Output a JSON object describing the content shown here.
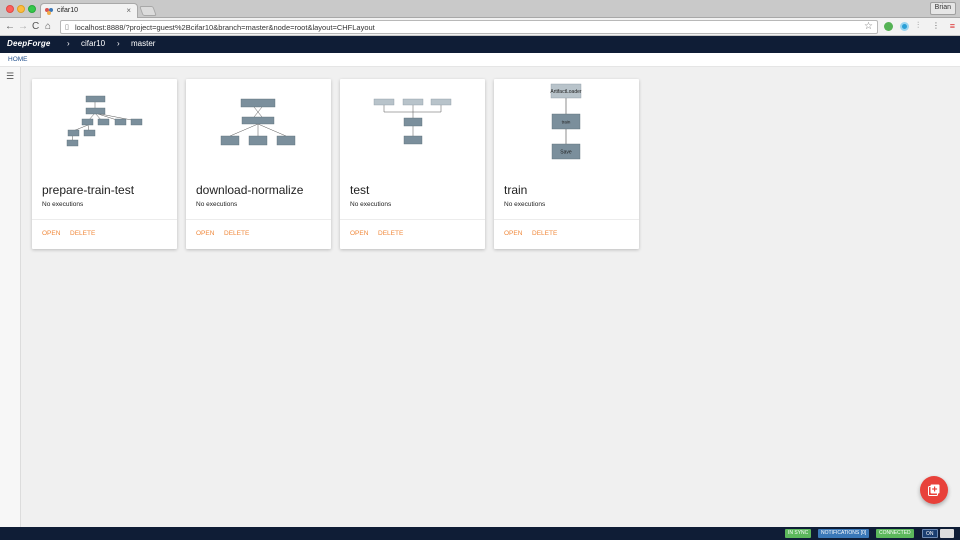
{
  "browser": {
    "tab_title": "cifar10",
    "user_name": "Brian",
    "url": "localhost:8888/?project=guest%2Bcifar10&branch=master&node=root&layout=CHFLayout"
  },
  "header": {
    "logo": "DeepForge",
    "project": "cifar10",
    "branch": "master"
  },
  "subnav": {
    "home": "HOME"
  },
  "cards": [
    {
      "title": "prepare-train-test",
      "status": "No executions",
      "open": "OPEN",
      "delete": "DELETE"
    },
    {
      "title": "download-normalize",
      "status": "No executions",
      "open": "OPEN",
      "delete": "DELETE"
    },
    {
      "title": "test",
      "status": "No executions",
      "open": "OPEN",
      "delete": "DELETE"
    },
    {
      "title": "train",
      "status": "No executions",
      "open": "OPEN",
      "delete": "DELETE",
      "nodes": [
        "ArtifactLoader",
        "train",
        "Save"
      ]
    }
  ],
  "footer": {
    "sync": "IN SYNC",
    "notifications": "NOTIFICATIONS [0]",
    "connected": "CONNECTED",
    "on": "ON"
  },
  "colors": {
    "header_bg": "#0f1d36",
    "accent": "#f0893c",
    "node_fill": "#7b8f9c",
    "fab": "#e8413a"
  },
  "icons": [
    "back-icon",
    "forward-icon",
    "reload-icon",
    "home-icon",
    "star-icon",
    "menu-icon",
    "hamburger-icon",
    "add-icon",
    "keyboard-icon"
  ]
}
